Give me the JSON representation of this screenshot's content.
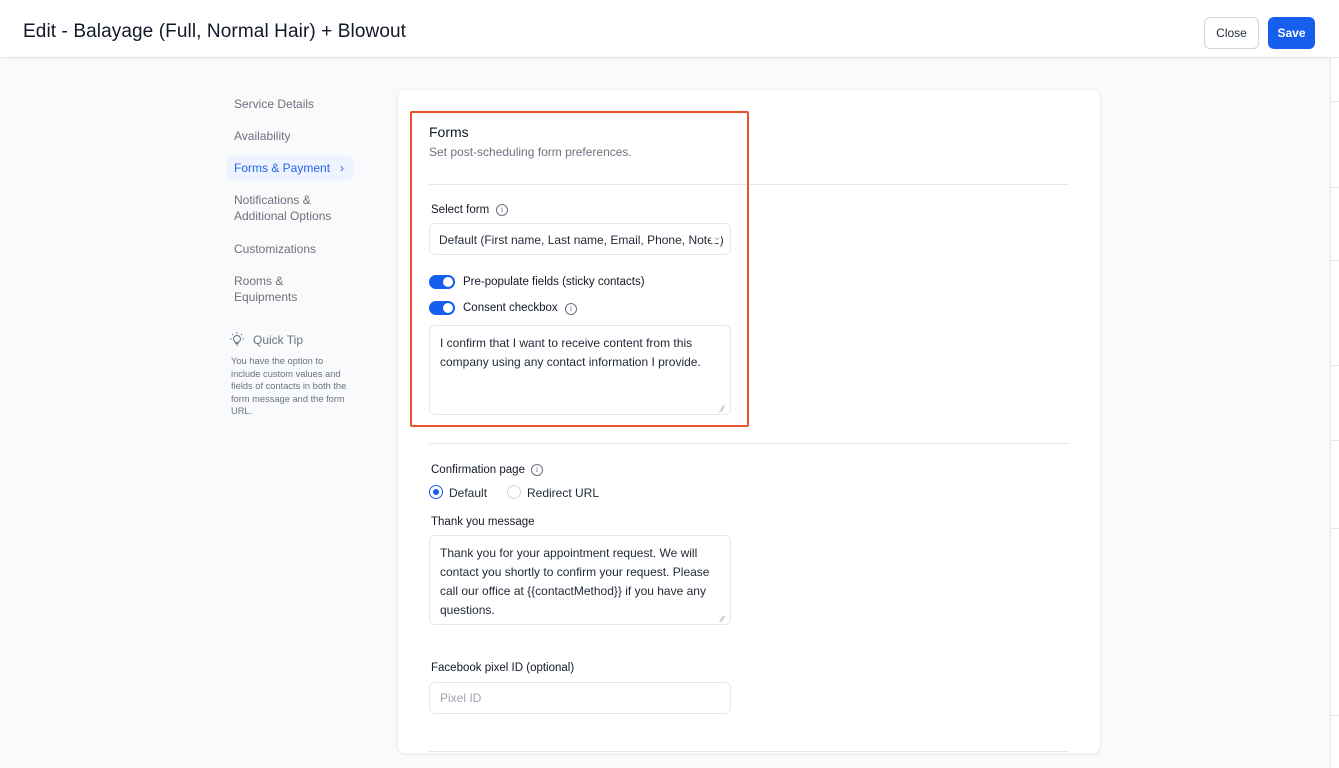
{
  "header": {
    "title": "Edit - Balayage (Full, Normal Hair) + Blowout",
    "close_label": "Close",
    "save_label": "Save"
  },
  "sidebar": {
    "items": [
      {
        "label": "Service Details",
        "active": false
      },
      {
        "label": "Availability",
        "active": false
      },
      {
        "label": "Forms & Payment",
        "active": true
      },
      {
        "label": "Notifications & Additional Options",
        "active": false
      },
      {
        "label": "Customizations",
        "active": false
      },
      {
        "label": "Rooms & Equipments",
        "active": false
      }
    ],
    "quick_tip": {
      "icon": "lightbulb-icon",
      "title": "Quick Tip",
      "text": "You have the option to include custom values and fields of contacts in both the form message and the form URL."
    }
  },
  "forms": {
    "title": "Forms",
    "description": "Set post-scheduling form preferences.",
    "select_form_label": "Select form",
    "select_form_value": "Default (First name, Last name, Email, Phone, Notes)",
    "prepopulate_label": "Pre-populate fields (sticky contacts)",
    "prepopulate_on": true,
    "consent_label": "Consent checkbox",
    "consent_on": true,
    "consent_text": "I confirm that I want to receive content from this company using any contact information I provide."
  },
  "confirmation": {
    "label": "Confirmation page",
    "options": [
      "Default",
      "Redirect URL"
    ],
    "selected": "Default",
    "thank_you_label": "Thank you message",
    "thank_you_text": "Thank you for your appointment request. We will contact you shortly to confirm your request. Please call our office at {{contactMethod}} if you have any questions."
  },
  "pixel": {
    "label": "Facebook pixel ID (optional)",
    "placeholder": "Pixel ID"
  },
  "colors": {
    "accent": "#155eef",
    "highlight": "#e8532f",
    "active_nav_bg": "#eef4ff"
  }
}
